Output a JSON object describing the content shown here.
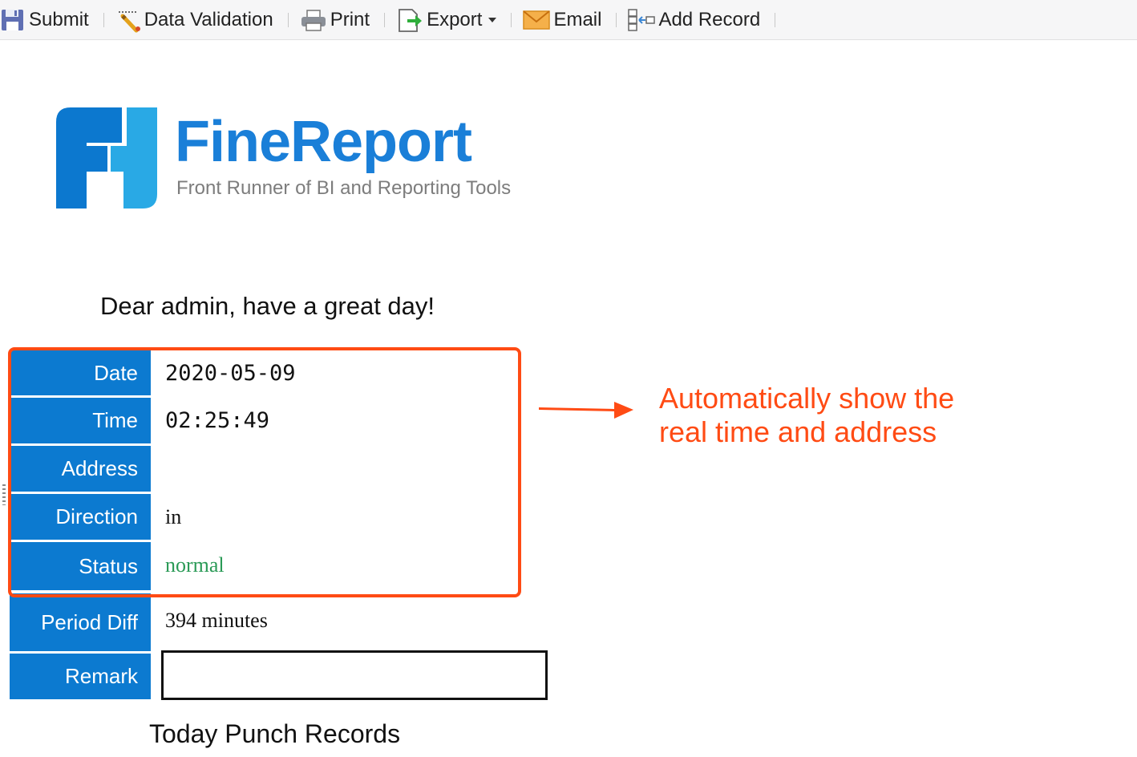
{
  "toolbar": {
    "submit": "Submit",
    "data_validation": "Data Validation",
    "print": "Print",
    "export": "Export",
    "email": "Email",
    "add_record": "Add Record"
  },
  "logo": {
    "title": "FineReport",
    "tagline": "Front Runner of BI and Reporting Tools"
  },
  "greeting": "Dear admin, have a great day!",
  "form": {
    "date_label": "Date",
    "date_value": "2020-05-09",
    "time_label": "Time",
    "time_value": "02:25:49",
    "address_label": "Address",
    "address_value": "",
    "direction_label": "Direction",
    "direction_value": "in",
    "status_label": "Status",
    "status_value": "normal",
    "period_diff_label": "Period Diff",
    "period_diff_value": "394 minutes",
    "remark_label": "Remark",
    "remark_value": ""
  },
  "annotation": {
    "line1": "Automatically show the",
    "line2": "real time and address"
  },
  "punch_records_title": "Today Punch Records",
  "colors": {
    "label_bg": "#0c7ad0",
    "highlight": "#ff4b14",
    "status_ok": "#2a9a56",
    "brand": "#1a7fd8"
  }
}
